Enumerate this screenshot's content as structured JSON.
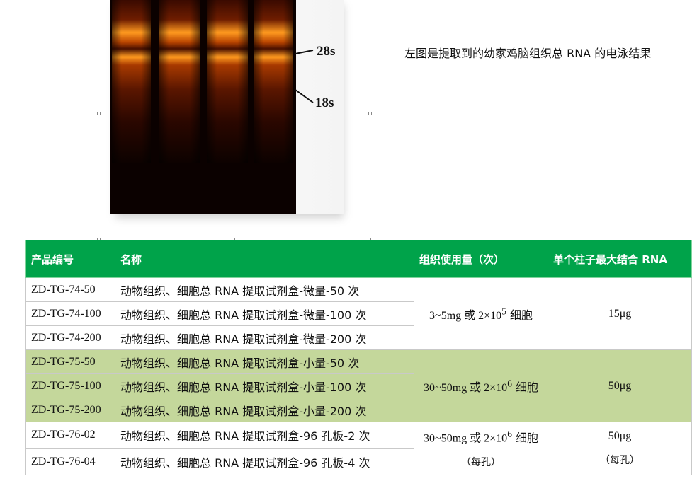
{
  "gel_figure": {
    "band_labels": [
      "28s",
      "18s"
    ],
    "lane_count": 4
  },
  "caption": "左图是提取到的幼家鸡脑组织总 RNA 的电泳结果",
  "table": {
    "headers": [
      "产品编号",
      "名称",
      "组织使用量（次）",
      "单个柱子最大结合 RNA"
    ],
    "rows": [
      {
        "code": "ZD-TG-74-50",
        "name": "动物组织、细胞总 RNA 提取试剂盒-微量-50 次"
      },
      {
        "code": "ZD-TG-74-100",
        "name": "动物组织、细胞总 RNA 提取试剂盒-微量-100 次"
      },
      {
        "code": "ZD-TG-74-200",
        "name": "动物组织、细胞总 RNA 提取试剂盒-微量-200 次"
      },
      {
        "code": "ZD-TG-75-50",
        "name": "动物组织、细胞总 RNA 提取试剂盒-小量-50 次"
      },
      {
        "code": "ZD-TG-75-100",
        "name": "动物组织、细胞总 RNA 提取试剂盒-小量-100 次"
      },
      {
        "code": "ZD-TG-75-200",
        "name": "动物组织、细胞总 RNA 提取试剂盒-小量-200 次"
      },
      {
        "code": "ZD-TG-76-02",
        "name": "动物组织、细胞总 RNA 提取试剂盒-96 孔板-2 次"
      },
      {
        "code": "ZD-TG-76-04",
        "name": "动物组织、细胞总 RNA 提取试剂盒-96 孔板-4 次"
      }
    ],
    "groups": [
      {
        "usage_pre": "3~5mg 或 2×10",
        "usage_exp": "5",
        "usage_post": " 细胞",
        "max_binding": "15μg"
      },
      {
        "usage_pre": "30~50mg 或 2×10",
        "usage_exp": "6",
        "usage_post": " 细胞",
        "max_binding": "50μg"
      },
      {
        "usage_pre": "30~50mg 或 2×10",
        "usage_exp": "6",
        "usage_post": " 细胞",
        "usage_note": "（每孔）",
        "max_binding": "50μg",
        "binding_note": "（每孔）"
      }
    ]
  },
  "colors": {
    "header_green": "#00a34a",
    "group_highlight": "#c4d79b"
  }
}
